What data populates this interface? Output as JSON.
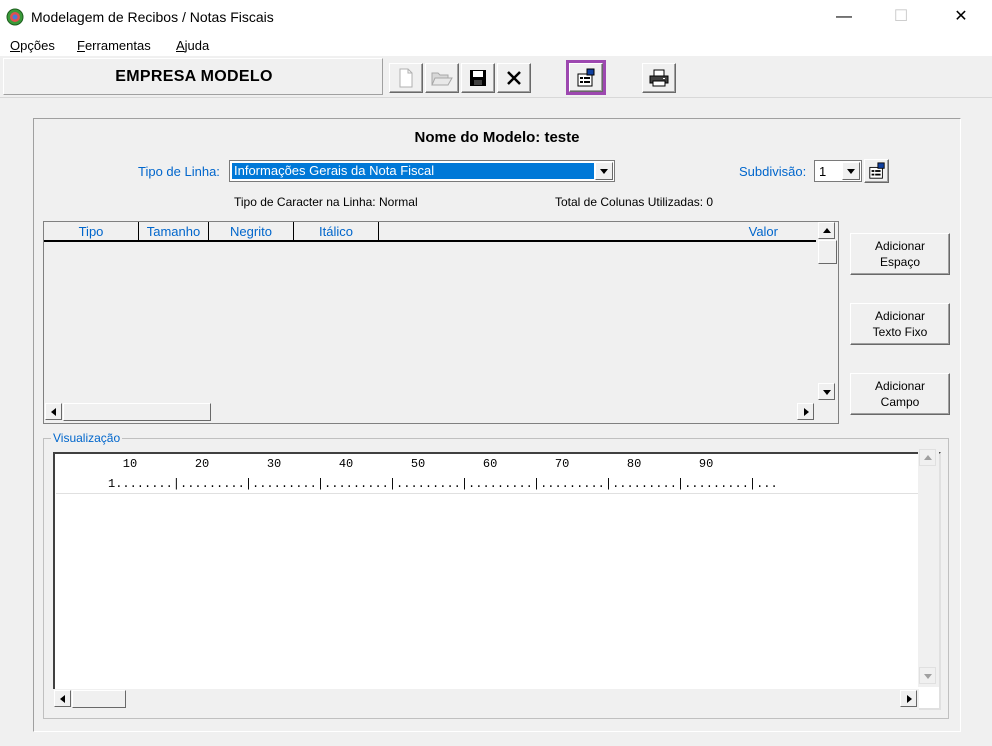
{
  "window": {
    "title": "Modelagem de Recibos / Notas Fiscais",
    "minimize": "—",
    "maximize": "☐",
    "close": "✕"
  },
  "menu": [
    {
      "accel": "O",
      "rest": "pções"
    },
    {
      "accel": "F",
      "rest": "erramentas"
    },
    {
      "accel": "A",
      "rest": "juda"
    }
  ],
  "toolbar": {
    "company": "EMPRESA MODELO",
    "buttons": [
      "new-document-icon",
      "open-folder-icon",
      "save-disk-icon",
      "delete-x-icon",
      "properties-icon",
      "print-icon"
    ],
    "highlight_color": "#9d48b0"
  },
  "form": {
    "model_title": "Nome do Modelo: teste",
    "line_type_label": "Tipo de Linha:",
    "line_type_value": "Informações Gerais da Nota Fiscal",
    "subdivision_label": "Subdivisão:",
    "subdivision_value": "1",
    "char_type": "Tipo de Caracter na Linha: Normal",
    "columns_used": "Total de Colunas Utilizadas: 0"
  },
  "grid": {
    "columns": [
      "Tipo",
      "Tamanho",
      "Negrito",
      "Itálico",
      "Valor"
    ],
    "rows": []
  },
  "buttons": {
    "add_space": [
      "Adicionar",
      "Espaço"
    ],
    "add_fixed_text": [
      "Adicionar",
      "Texto Fixo"
    ],
    "add_field": [
      "Adicionar",
      "Campo"
    ]
  },
  "visualization": {
    "label": "Visualização",
    "ruler_numbers": "         10        20        30        40        50        60        70        80        90",
    "ruler_ticks": "1........|.........|.........|.........|.........|.........|.........|.........|.........|..."
  },
  "colors": {
    "label_blue": "#0066cc",
    "selection_blue": "#0078d7"
  }
}
